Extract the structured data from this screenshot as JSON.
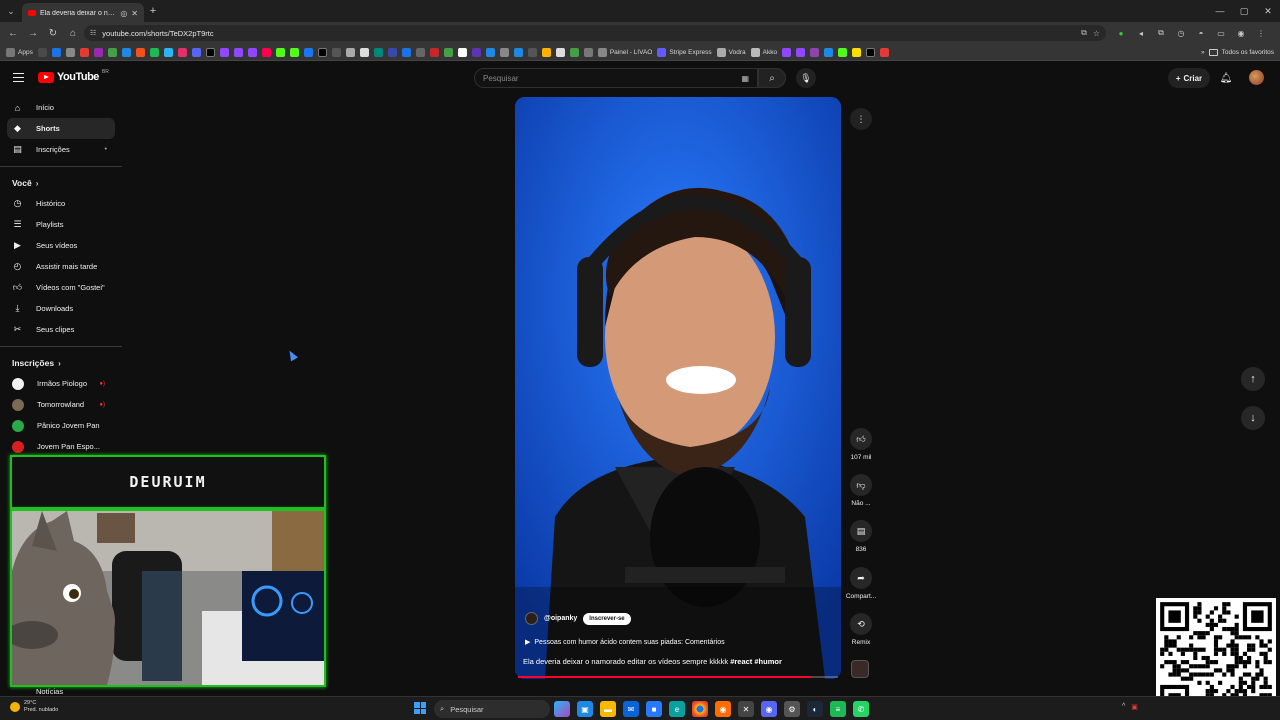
{
  "browser": {
    "tab_title": "Ela deveria deixar o namorado edi",
    "new_tab": "+",
    "url": "youtube.com/shorts/TeDX2pT9rtc",
    "bookmarks": {
      "apps_label": "Apps",
      "items": [
        "Painel - LIVAO",
        "Stripe Express",
        "Vodra",
        "Akko"
      ],
      "all_bookmarks": "Todos os favoritos"
    },
    "window_controls": [
      "—",
      "▢",
      "✕"
    ]
  },
  "youtube": {
    "logo_text": "YouTube",
    "logo_country": "BR",
    "search_placeholder": "Pesquisar",
    "create_label": "Criar",
    "sidebar": {
      "main": [
        {
          "label": "Início",
          "icon": "home-icon"
        },
        {
          "label": "Shorts",
          "icon": "shorts-icon",
          "active": true
        },
        {
          "label": "Inscrições",
          "icon": "subscriptions-icon"
        }
      ],
      "you_heading": "Você",
      "you_items": [
        {
          "label": "Histórico",
          "icon": "history-icon"
        },
        {
          "label": "Playlists",
          "icon": "playlists-icon"
        },
        {
          "label": "Seus vídeos",
          "icon": "your-videos-icon"
        },
        {
          "label": "Assistir mais tarde",
          "icon": "watch-later-icon"
        },
        {
          "label": "Vídeos com \"Gostei\"",
          "icon": "liked-icon"
        },
        {
          "label": "Downloads",
          "icon": "download-icon"
        },
        {
          "label": "Seus clipes",
          "icon": "clips-icon"
        }
      ],
      "subs_heading": "Inscrições",
      "subs": [
        {
          "label": "Irmãos Piologo",
          "color": "#f2f2f2"
        },
        {
          "label": "Tomorrowland",
          "color": "#7b6a55"
        },
        {
          "label": "Pânico Jovem Pan",
          "color": "#2aa84a"
        },
        {
          "label": "Jovem Pan Espo...",
          "color": "#d82020"
        }
      ],
      "bottom_item": "Notícias"
    },
    "short": {
      "channel_handle": "@oipanky",
      "subscribe_label": "Inscrever-se",
      "playlist_text": "Pessoas com humor ácido contem suas piadas: Comentários",
      "description_text": "Ela deveria deixar o namorado editar os vídeos sempre kkkkk",
      "description_tags": "#react #humor",
      "progress": 0.92,
      "actions": [
        {
          "icon": "like-icon",
          "label": "107 mil"
        },
        {
          "icon": "dislike-icon",
          "label": "Não ..."
        },
        {
          "icon": "comments-icon",
          "label": "836"
        },
        {
          "icon": "share-icon",
          "label": "Compart..."
        },
        {
          "icon": "remix-icon",
          "label": "Remix"
        }
      ]
    }
  },
  "overlay": {
    "streamer_name": "DEURUIM",
    "accent": "#20c020"
  },
  "taskbar": {
    "weather_temp": "29°C",
    "weather_desc": "Pred. nublado",
    "search_label": "Pesquisar"
  }
}
